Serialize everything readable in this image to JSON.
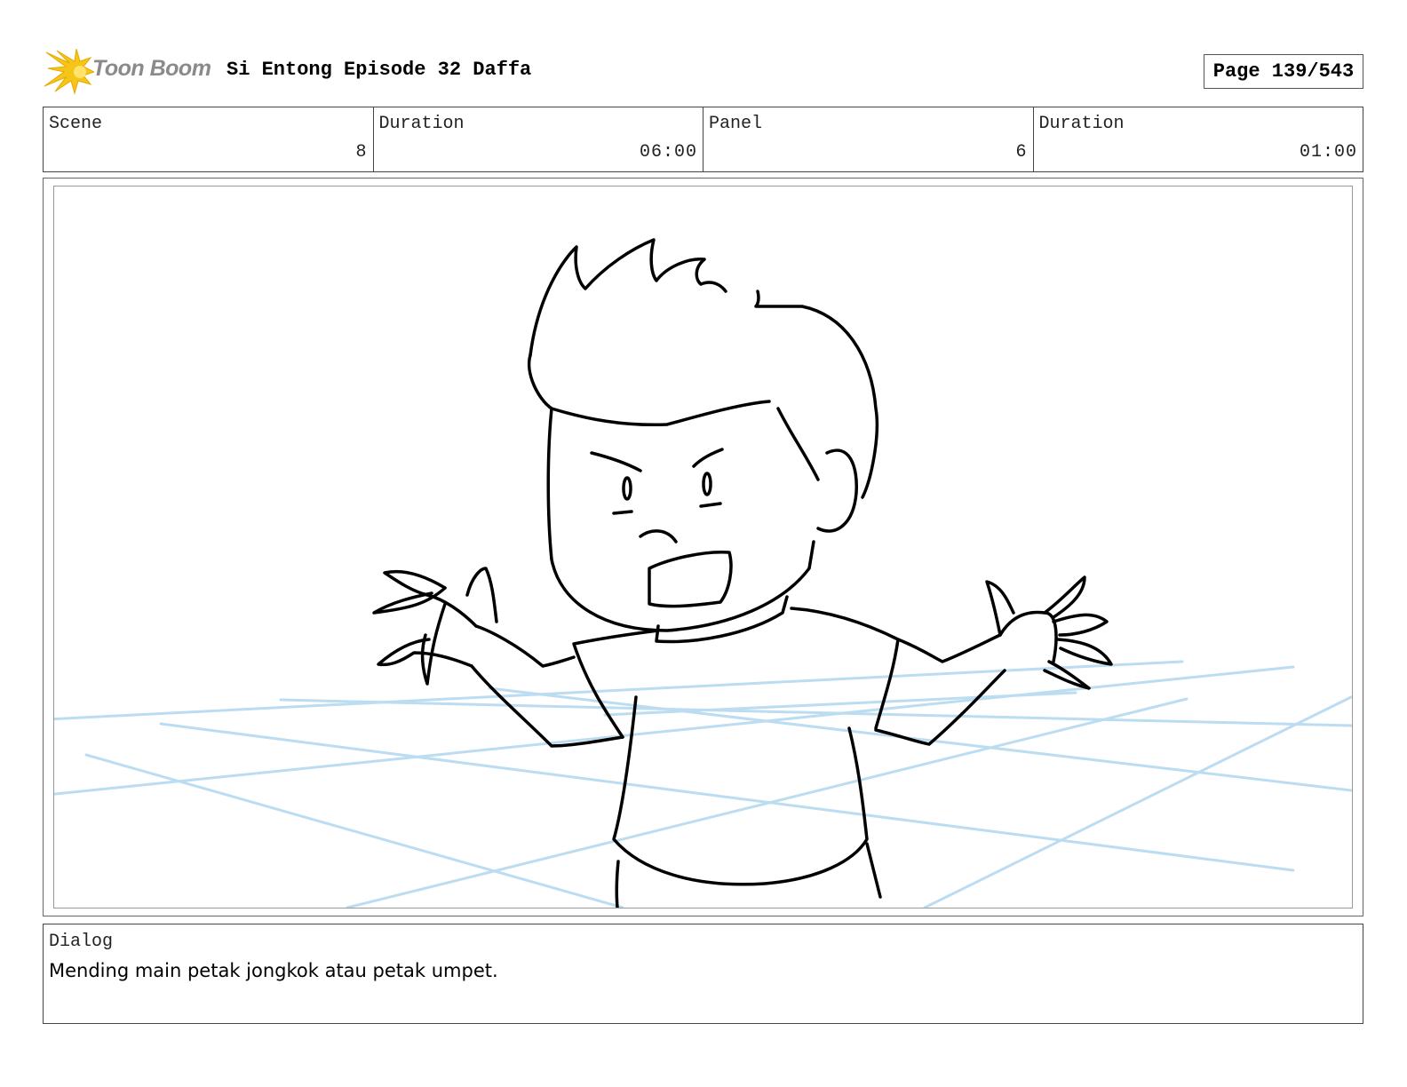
{
  "header": {
    "logo_text": "Toon Boom",
    "title": "Si Entong Episode 32 Daffa",
    "page_indicator": "Page 139/543"
  },
  "info": {
    "scene_label": "Scene",
    "scene_value": "8",
    "scene_duration_label": "Duration",
    "scene_duration_value": "06:00",
    "panel_label": "Panel",
    "panel_value": "6",
    "panel_duration_label": "Duration",
    "panel_duration_value": "01:00"
  },
  "panel": {
    "icon": "storyboard-sketch-boy-shrugging",
    "guide_color": "#bcdcf2",
    "line_color": "#000000"
  },
  "dialog": {
    "label": "Dialog",
    "text": "Mending main petak jongkok atau petak umpet."
  }
}
